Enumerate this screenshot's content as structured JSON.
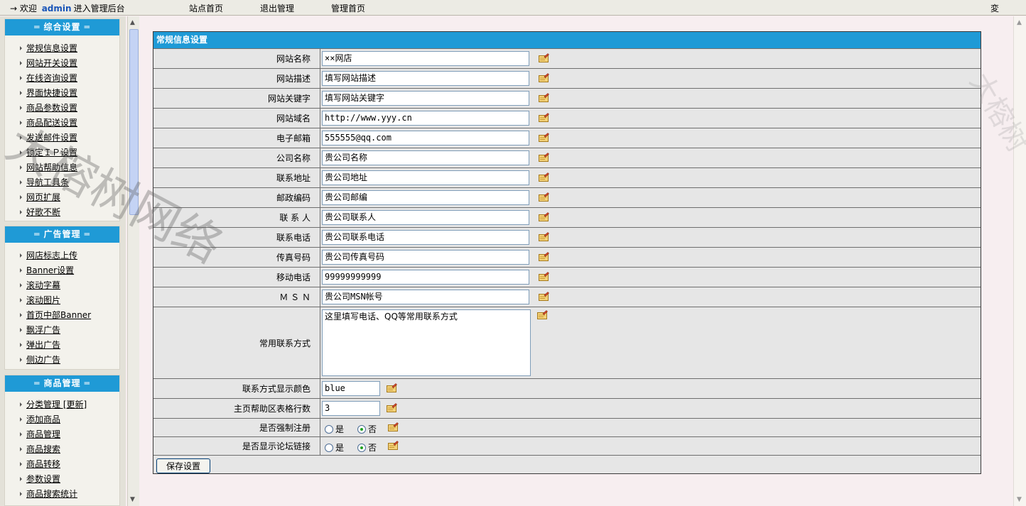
{
  "topbar": {
    "welcome_prefix": "→ 欢迎",
    "username": "admin",
    "welcome_suffix": "进入管理后台",
    "nav": [
      "站点首页",
      "退出管理",
      "管理首页"
    ],
    "edge_text": "変"
  },
  "sidebar": {
    "groups": [
      {
        "title": "═ 综合设置 ═",
        "items": [
          "常规信息设置",
          "网站开关设置",
          "在线咨询设置",
          "界面快捷设置",
          "商品参数设置",
          "商品配送设置",
          "发送邮件设置",
          "锁定ＩＰ设置",
          "网站帮助信息",
          "导航工具条",
          "网页扩展",
          "好歌不断"
        ]
      },
      {
        "title": "═ 广告管理 ═",
        "items": [
          "网店标志上传",
          "Banner设置",
          "滚动字幕",
          "滚动图片",
          "首页中部Banner",
          "飘浮广告",
          "弹出广告",
          "侧边广告"
        ]
      },
      {
        "title": "═ 商品管理 ═",
        "items": [
          "分类管理 [更新]",
          "添加商品",
          "商品管理",
          "商品搜索",
          "商品转移",
          "参数设置",
          "商品搜索统计"
        ]
      }
    ]
  },
  "form": {
    "title": "常规信息设置",
    "fields": [
      {
        "label": "网站名称",
        "value": "××网店"
      },
      {
        "label": "网站描述",
        "value": "填写网站描述"
      },
      {
        "label": "网站关键字",
        "value": "填写网站关键字"
      },
      {
        "label": "网站域名",
        "value": "http://www.yyy.cn"
      },
      {
        "label": "电子邮箱",
        "value": "555555@qq.com"
      },
      {
        "label": "公司名称",
        "value": "贵公司名称"
      },
      {
        "label": "联系地址",
        "value": "贵公司地址"
      },
      {
        "label": "邮政编码",
        "value": "贵公司邮编"
      },
      {
        "label": "联 系 人",
        "value": "贵公司联系人"
      },
      {
        "label": "联系电话",
        "value": "贵公司联系电话"
      },
      {
        "label": "传真号码",
        "value": "贵公司传真号码"
      },
      {
        "label": "移动电话",
        "value": "99999999999"
      },
      {
        "label": "Ｍ Ｓ Ｎ",
        "value": "贵公司MSN帐号"
      }
    ],
    "contact": {
      "label": "常用联系方式",
      "value": "这里填写电话、QQ等常用联系方式"
    },
    "small_fields": [
      {
        "label": "联系方式显示颜色",
        "value": "blue"
      },
      {
        "label": "主页帮助区表格行数",
        "value": "3"
      }
    ],
    "radios": [
      {
        "label": "是否强制注册",
        "yes": "是",
        "no": "否",
        "selected": "no"
      },
      {
        "label": "是否显示论坛链接",
        "yes": "是",
        "no": "否",
        "selected": "no"
      }
    ],
    "save_label": "保存设置"
  },
  "watermark": "大榕树网络",
  "watermark_right": "大榕树"
}
